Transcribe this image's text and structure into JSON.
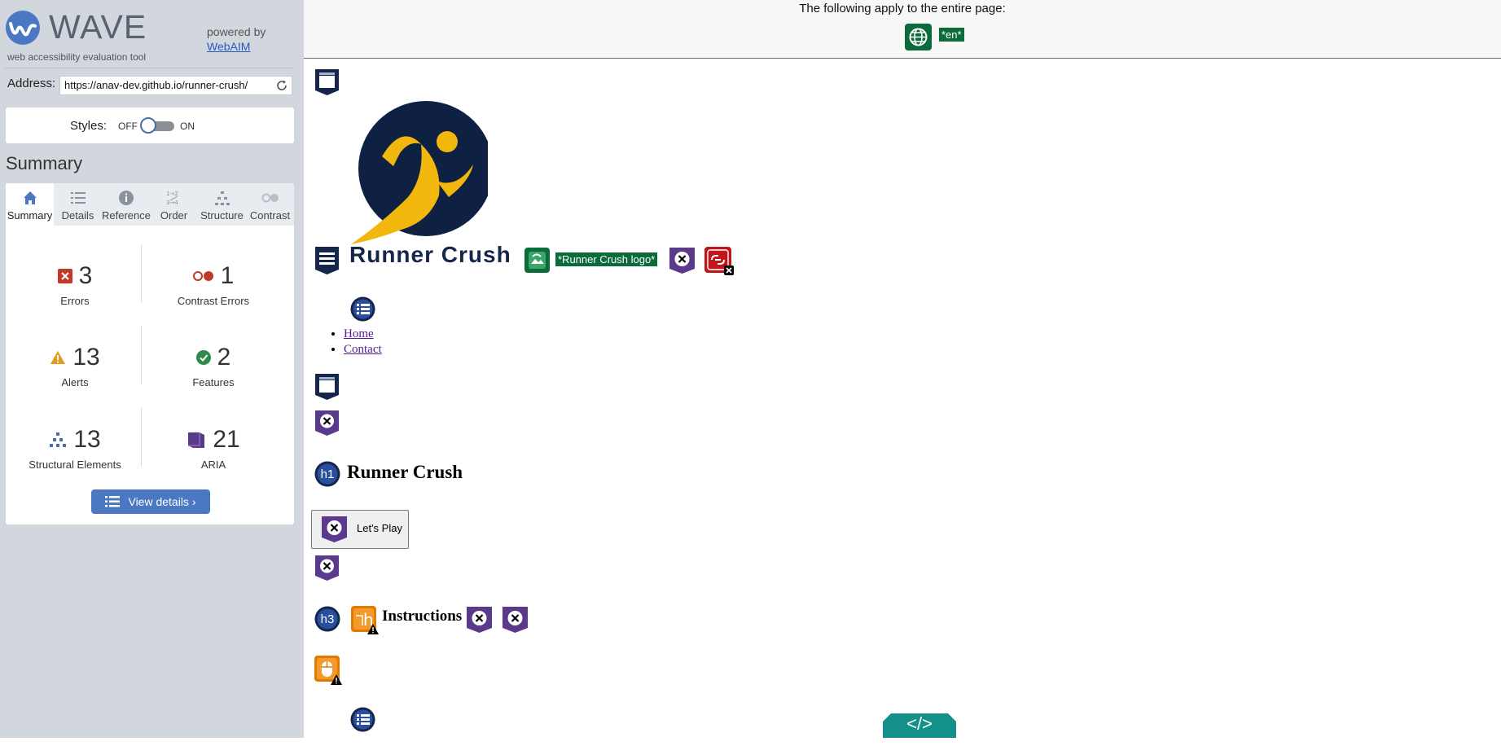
{
  "sidebar": {
    "brand": {
      "name": "WAVE",
      "tagline": "web accessibility evaluation tool",
      "powered_by": "powered by",
      "powered_by_link": "WebAIM"
    },
    "address": {
      "label": "Address:",
      "value": "https://anav-dev.github.io/runner-crush/"
    },
    "styles": {
      "label": "Styles:",
      "off": "OFF",
      "on": "ON",
      "state": "OFF"
    },
    "summary_heading": "Summary",
    "tabs": [
      {
        "label": "Summary",
        "icon": "home-icon",
        "active": true
      },
      {
        "label": "Details",
        "icon": "list-icon",
        "active": false
      },
      {
        "label": "Reference",
        "icon": "info-icon",
        "active": false
      },
      {
        "label": "Order",
        "icon": "order-icon",
        "active": false
      },
      {
        "label": "Structure",
        "icon": "structure-icon",
        "active": false
      },
      {
        "label": "Contrast",
        "icon": "contrast-icon",
        "active": false
      }
    ],
    "stats": [
      {
        "count": "3",
        "label": "Errors",
        "icon": "error-icon",
        "color": "#c0392b"
      },
      {
        "count": "1",
        "label": "Contrast Errors",
        "icon": "contrast-error-icon",
        "color": "#c0392b"
      },
      {
        "count": "13",
        "label": "Alerts",
        "icon": "alert-icon",
        "color": "#e09b1e"
      },
      {
        "count": "2",
        "label": "Features",
        "icon": "feature-icon",
        "color": "#2f8a4d"
      },
      {
        "count": "13",
        "label": "Structural Elements",
        "icon": "structure-icon",
        "color": "#4a6fa5"
      },
      {
        "count": "21",
        "label": "ARIA",
        "icon": "aria-icon",
        "color": "#5b3a8c"
      }
    ],
    "view_details": "View details ›"
  },
  "page": {
    "doc_notice": "The following apply to the entire page:",
    "lang": "*en*",
    "image_alt": "*Runner Crush logo*",
    "site_title": "Runner Crush",
    "nav": [
      "Home",
      "Contact"
    ],
    "h1": "Runner Crush",
    "h1_badge": "h1",
    "h3_badge": "h3",
    "play_button": "Let's Play",
    "h3": "Instructions",
    "code_label": "</>"
  },
  "colors": {
    "sidebar_bg": "#d2d7de",
    "structure_blue": "#16264a",
    "aria_purple": "#5b3a8c",
    "error_red": "#c0392b",
    "alert_orange": "#e07b00",
    "feature_green": "#0b6b3a",
    "logo_gold": "#f2b70d"
  }
}
